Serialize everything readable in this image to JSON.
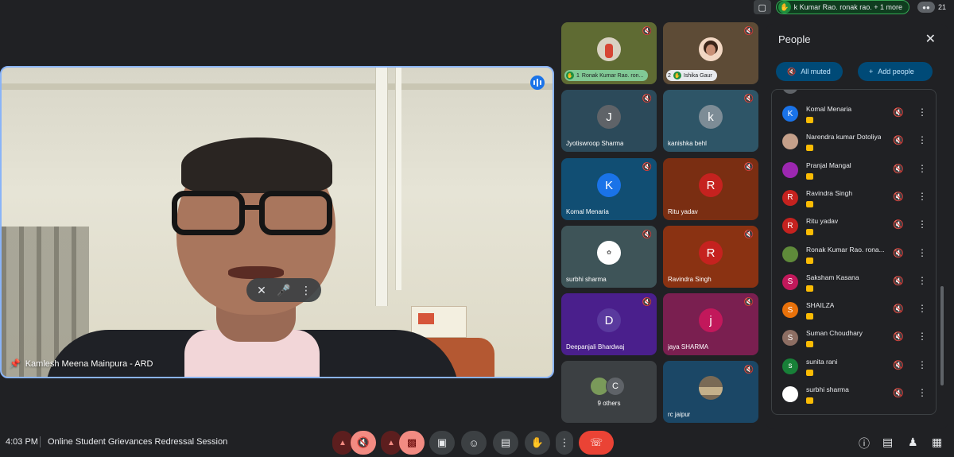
{
  "topbar": {
    "hand_raise_text": "k Kumar Rao. ronak rao. + 1 more",
    "participant_count": "21"
  },
  "main_tile": {
    "name": "Kamlesh Meena Mainpura - ARD"
  },
  "tiles": [
    {
      "name": "Ronak Kumar Rao. ron...",
      "hand_order": "1",
      "bg": "#5f6b33",
      "kind": "hand"
    },
    {
      "name": "Ishika Gaur",
      "hand_order": "2",
      "bg": "#5d4b36",
      "kind": "hand"
    },
    {
      "name": "Jyotiswroop Sharma",
      "initial": "J",
      "bg": "#2c4a5a",
      "avatar_bg": "#5f6368"
    },
    {
      "name": "kanishka behl",
      "initial": "k",
      "bg": "#2e5567",
      "avatar_bg": "#7d8c96"
    },
    {
      "name": "Komal Menaria",
      "initial": "K",
      "bg": "#114e73",
      "avatar_bg": "#1a73e8"
    },
    {
      "name": "Ritu yadav",
      "initial": "R",
      "bg": "#7a2e12",
      "avatar_bg": "#c5221f"
    },
    {
      "name": "surbhi sharma",
      "initial": "",
      "bg": "#3e5458",
      "avatar_bg": "#ffffff"
    },
    {
      "name": "Ravindra Singh",
      "initial": "R",
      "bg": "#8a3212",
      "avatar_bg": "#c5221f"
    },
    {
      "name": "Deepanjali Bhardwaj",
      "initial": "D",
      "bg": "#4a1f8c",
      "avatar_bg": "#5a3a9e"
    },
    {
      "name": "jaya SHARMA",
      "initial": "j",
      "bg": "#7a1f50",
      "avatar_bg": "#c2185b"
    },
    {
      "name": "9 others",
      "initial": "C",
      "bg": "#3c4043",
      "kind": "others"
    },
    {
      "name": "rc jaipur",
      "initial": "",
      "bg": "#1b4766",
      "kind": "photo"
    }
  ],
  "panel": {
    "title": "People",
    "all_muted_label": "All muted",
    "add_people_label": "Add people",
    "people": [
      {
        "name": "Komal Menaria",
        "initial": "K",
        "color": "#1a73e8"
      },
      {
        "name": "Narendra kumar Dotoliya",
        "initial": "",
        "color": "#c5a08a"
      },
      {
        "name": "Pranjal Mangal",
        "initial": "",
        "color": "#9c27b0"
      },
      {
        "name": "Ravindra Singh",
        "initial": "R",
        "color": "#c5221f"
      },
      {
        "name": "Ritu yadav",
        "initial": "R",
        "color": "#c5221f"
      },
      {
        "name": "Ronak Kumar Rao. rona...",
        "initial": "",
        "color": "#5f8a3a"
      },
      {
        "name": "Saksham Kasana",
        "initial": "S",
        "color": "#c2185b"
      },
      {
        "name": "SHAILZA",
        "initial": "S",
        "color": "#e8710a"
      },
      {
        "name": "Suman Choudhary",
        "initial": "S",
        "color": "#8d6e63"
      },
      {
        "name": "sunita rani",
        "initial": "s",
        "color": "#188038"
      },
      {
        "name": "surbhi sharma",
        "initial": "",
        "color": "#ffffff"
      }
    ]
  },
  "bottombar": {
    "time": "4:03 PM",
    "meeting_title": "Online Student Grievances Redressal Session"
  }
}
